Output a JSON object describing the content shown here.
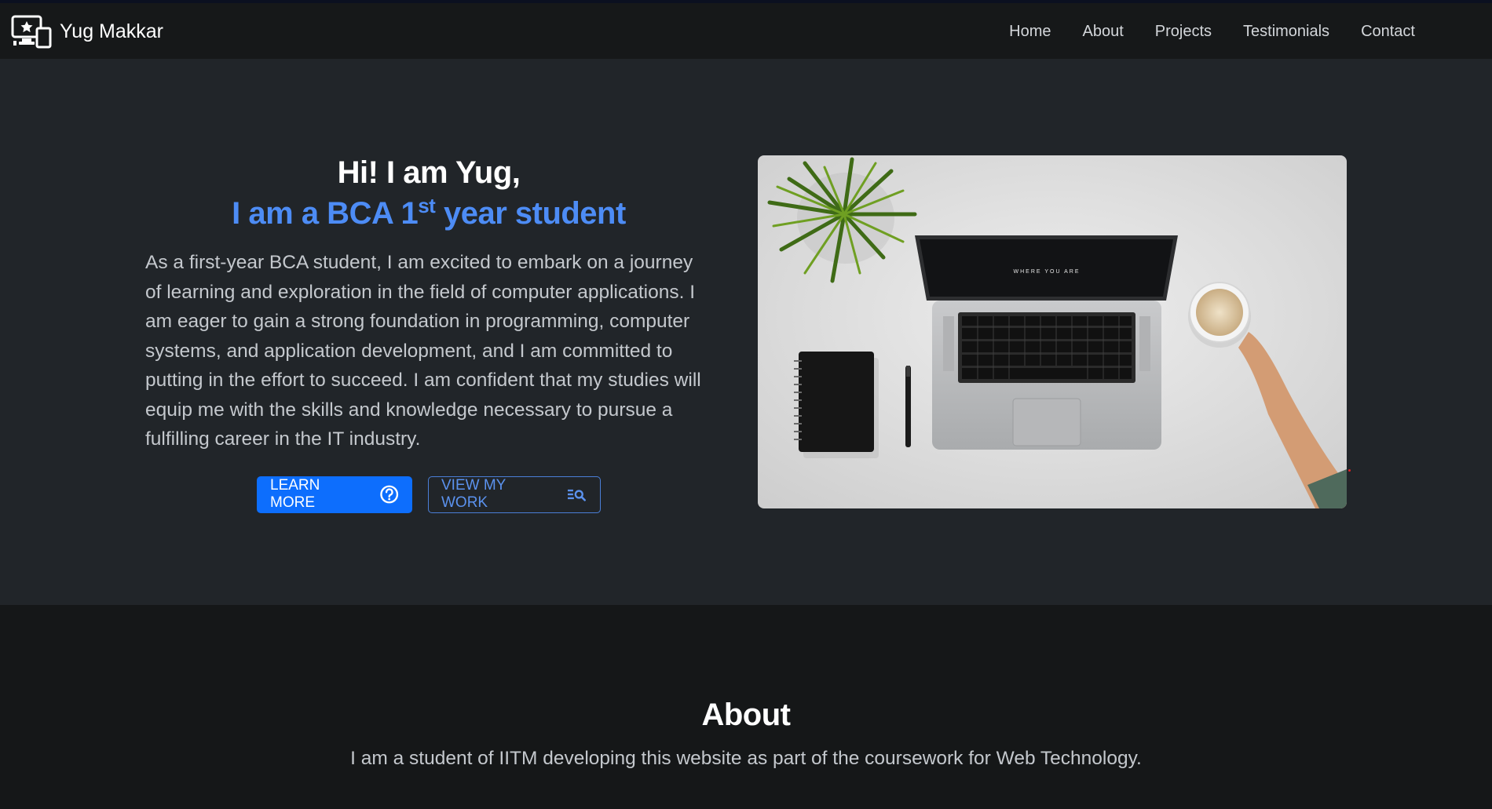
{
  "brand": {
    "name": "Yug Makkar",
    "icon": "screen-star-devices-icon"
  },
  "nav": {
    "items": [
      {
        "label": "Home"
      },
      {
        "label": "About"
      },
      {
        "label": "Projects"
      },
      {
        "label": "Testimonials"
      },
      {
        "label": "Contact"
      }
    ]
  },
  "hero": {
    "greeting": "Hi! I am Yug,",
    "subtitle_pre": "I am a BCA 1",
    "subtitle_sup": "st",
    "subtitle_post": " year student",
    "paragraph": "As a first-year BCA student, I am excited to embark on a journey of learning and exploration in the field of computer applications. I am eager to gain a strong foundation in programming, computer systems, and application development, and I am committed to putting in the effort to succeed. I am confident that my studies will equip me with the skills and knowledge necessary to pursue a fulfilling career in the IT industry.",
    "learn_more_label": "LEARN MORE",
    "learn_more_icon": "question-circle-icon",
    "view_work_label": "VIEW MY WORK",
    "view_work_icon": "list-search-icon",
    "image_alt": "laptop-desk-photo",
    "laptop_screen_text": "WHERE YOU ARE"
  },
  "about": {
    "title": "About",
    "text": "I am a student of IITM developing this website as part of the coursework for Web Technology."
  },
  "colors": {
    "page_bg": "#212529",
    "navbar_bg": "#161819",
    "about_bg": "#151718",
    "accent": "#4d8cf5",
    "primary_button": "#0d6efd"
  }
}
